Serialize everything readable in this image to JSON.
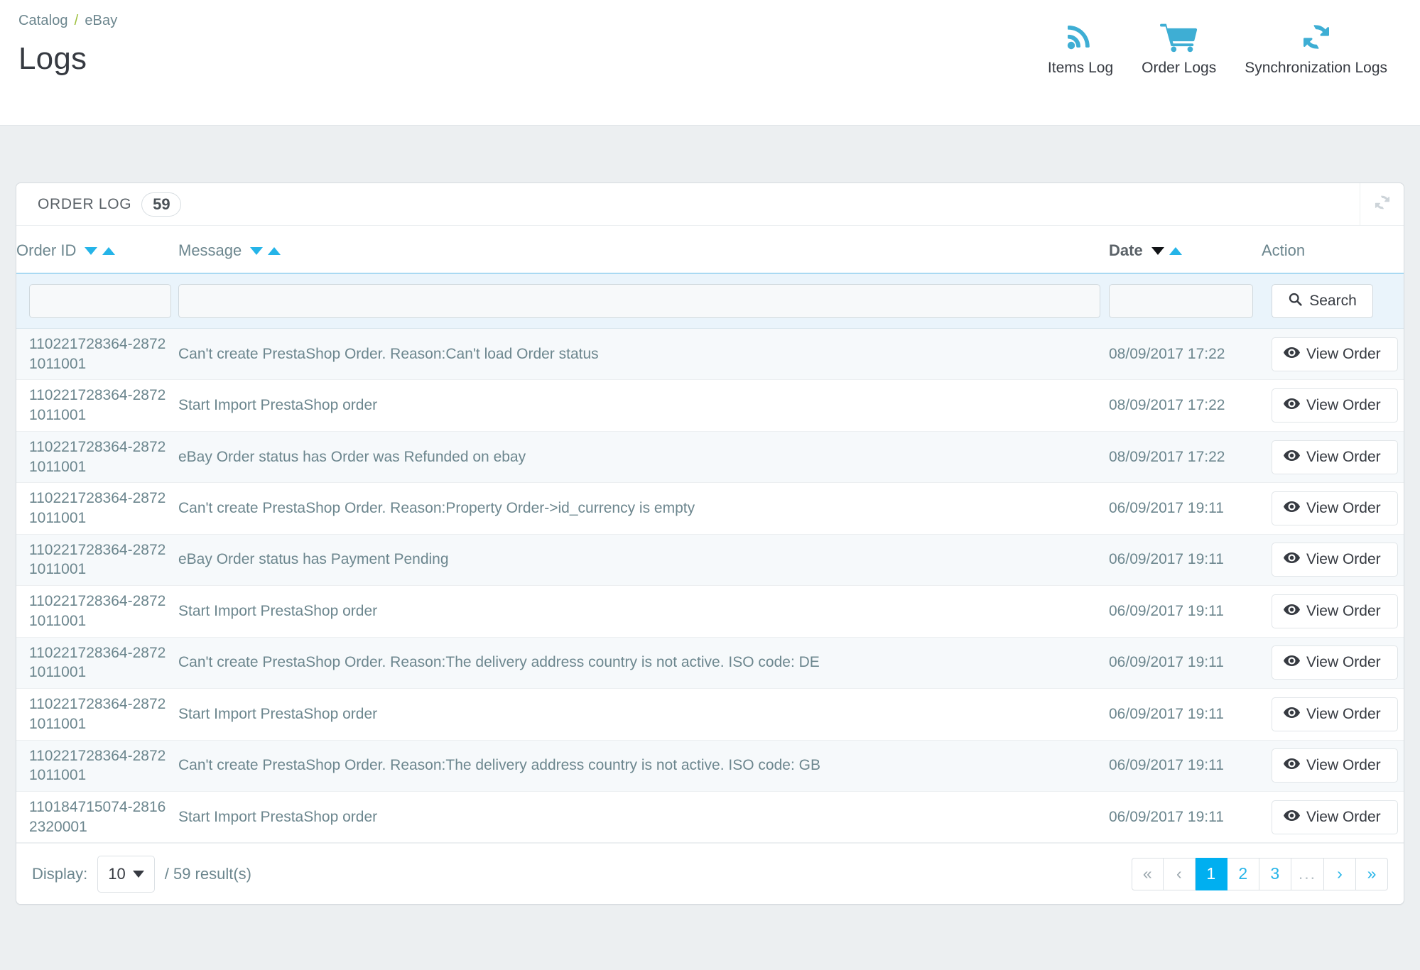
{
  "header": {
    "breadcrumb": {
      "parent": "Catalog",
      "separator": "/",
      "current": "eBay"
    },
    "title": "Logs",
    "actions": [
      {
        "icon": "rss-feed-icon",
        "label": "Items Log"
      },
      {
        "icon": "shopping-cart-icon",
        "label": "Order Logs"
      },
      {
        "icon": "sync-refresh-icon",
        "label": "Synchronization Logs"
      }
    ]
  },
  "panel": {
    "heading": "ORDER LOG",
    "count": "59",
    "refresh_icon": "refresh-icon"
  },
  "table": {
    "columns": {
      "order_id": "Order ID",
      "message": "Message",
      "date": "Date",
      "action": "Action"
    },
    "sort_active_column": "Date",
    "filters": {
      "order_id_value": "",
      "message_value": "",
      "date_value": "",
      "order_id_placeholder": "",
      "message_placeholder": "",
      "date_placeholder": "",
      "search_label": "Search",
      "search_icon": "search-icon"
    },
    "row_action_label": "View Order",
    "row_action_icon": "eye-icon",
    "rows": [
      {
        "order_id": "110221728364-28721011001",
        "message": "Can't create PrestaShop Order. Reason:Can't load Order status",
        "date": "08/09/2017 17:22"
      },
      {
        "order_id": "110221728364-28721011001",
        "message": "Start Import PrestaShop order",
        "date": "08/09/2017 17:22"
      },
      {
        "order_id": "110221728364-28721011001",
        "message": "eBay Order status has Order was Refunded on ebay",
        "date": "08/09/2017 17:22"
      },
      {
        "order_id": "110221728364-28721011001",
        "message": "Can't create PrestaShop Order. Reason:Property Order->id_currency is empty",
        "date": "06/09/2017 19:11"
      },
      {
        "order_id": "110221728364-28721011001",
        "message": "eBay Order status has Payment Pending",
        "date": "06/09/2017 19:11"
      },
      {
        "order_id": "110221728364-28721011001",
        "message": "Start Import PrestaShop order",
        "date": "06/09/2017 19:11"
      },
      {
        "order_id": "110221728364-28721011001",
        "message": "Can't create PrestaShop Order. Reason:The delivery address country is not active. ISO code: DE",
        "date": "06/09/2017 19:11"
      },
      {
        "order_id": "110221728364-28721011001",
        "message": "Start Import PrestaShop order",
        "date": "06/09/2017 19:11"
      },
      {
        "order_id": "110221728364-28721011001",
        "message": "Can't create PrestaShop Order. Reason:The delivery address country is not active. ISO code: GB",
        "date": "06/09/2017 19:11"
      },
      {
        "order_id": "110184715074-28162320001",
        "message": "Start Import PrestaShop order",
        "date": "06/09/2017 19:11"
      }
    ]
  },
  "footer": {
    "display_label": "Display:",
    "page_size": "10",
    "results_text": "/ 59 result(s)",
    "pagination": [
      {
        "label": "«",
        "name": "first-page",
        "state": "muted"
      },
      {
        "label": "‹",
        "name": "prev-page",
        "state": "muted"
      },
      {
        "label": "1",
        "name": "page-1",
        "state": "active"
      },
      {
        "label": "2",
        "name": "page-2",
        "state": "normal"
      },
      {
        "label": "3",
        "name": "page-3",
        "state": "normal"
      },
      {
        "label": "...",
        "name": "page-ellipsis",
        "state": "dots"
      },
      {
        "label": "›",
        "name": "next-page",
        "state": "normal"
      },
      {
        "label": "»",
        "name": "last-page",
        "state": "normal"
      }
    ]
  },
  "colors": {
    "accent_blue": "#25b4e8",
    "active_page_blue": "#00aff0",
    "breadcrumb_separator_green": "#9cbf3b",
    "body_background": "#eceff1",
    "filter_row_background": "#eaf4fb"
  }
}
